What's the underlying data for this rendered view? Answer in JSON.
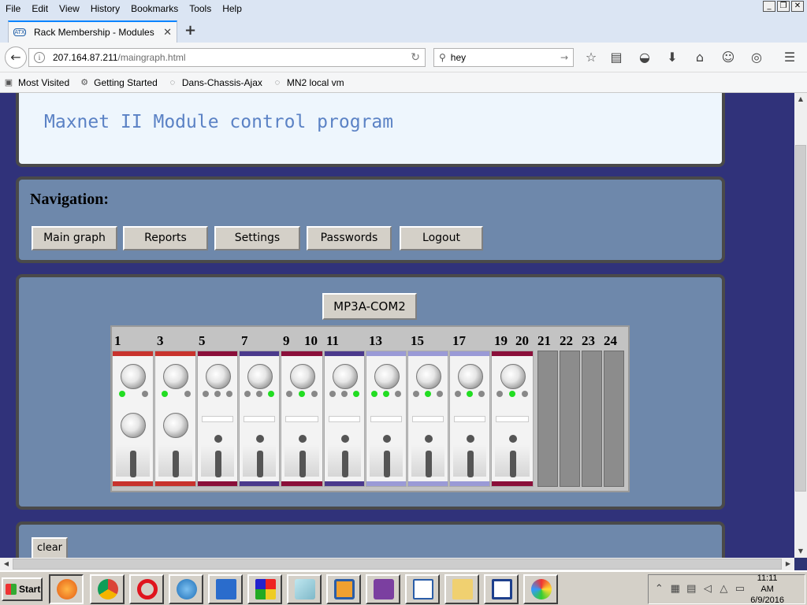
{
  "menubar": {
    "items": [
      "File",
      "Edit",
      "View",
      "History",
      "Bookmarks",
      "Tools",
      "Help"
    ],
    "window_controls": [
      "_",
      "❐",
      "✕"
    ]
  },
  "tab": {
    "title": "Rack Membership - Modules",
    "favicon_text": "ATX",
    "close": "✕",
    "new_tab": "+"
  },
  "url": {
    "host": "207.164.87.211",
    "path": "/maingraph.html"
  },
  "search": {
    "value": "hey"
  },
  "toolbar_icons": [
    "bookmark-star-icon",
    "reading-list-icon",
    "pocket-icon",
    "download-icon",
    "home-icon",
    "chat-icon",
    "globe-icon",
    "menu-icon"
  ],
  "bookmarks": [
    "Most Visited",
    "Getting Started",
    "Dans-Chassis-Ajax",
    "MN2 local vm"
  ],
  "header": {
    "subtitle": "Maxnet II Module control program"
  },
  "navigation": {
    "heading": "Navigation:",
    "buttons": [
      "Main graph",
      "Reports",
      "Settings",
      "Passwords",
      "Logout"
    ]
  },
  "rack": {
    "module_button": "MP3A-COM2",
    "slot_labels": [
      "1",
      "3",
      "5",
      "7",
      "9",
      "10",
      "11",
      "13",
      "15",
      "17",
      "19",
      "20",
      "21",
      "22",
      "23",
      "24"
    ]
  },
  "clear_button": "clear",
  "taskbar": {
    "start_label": "Start",
    "clock_time": "11:11 AM",
    "clock_date": "6/9/2016"
  },
  "colors": {
    "red": "#c8332d",
    "maroon": "#8a0f3a",
    "purple": "#4b3a8c",
    "lavender": "#9a9ad6",
    "led_green": "#22dd22"
  }
}
